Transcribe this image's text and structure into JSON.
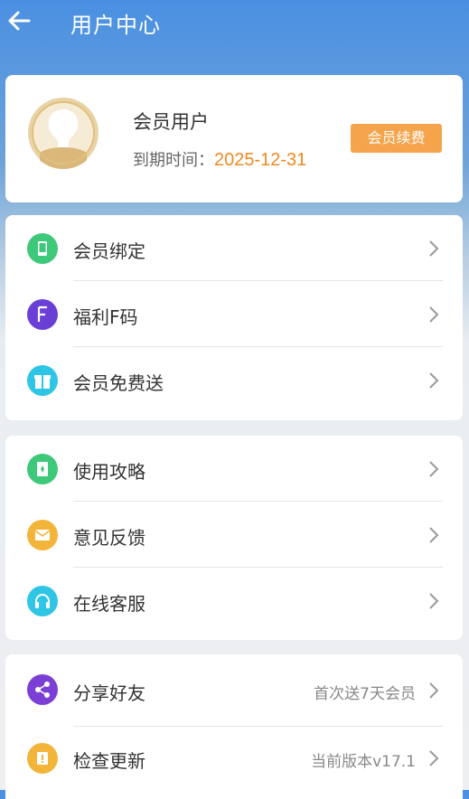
{
  "header": {
    "title": "用户中心"
  },
  "profile": {
    "name": "会员用户",
    "expire_label": "到期时间：",
    "expire_date": "2025-12-31",
    "renew_label": "会员续费"
  },
  "groups": [
    {
      "items": [
        {
          "label": "会员绑定",
          "icon": "phone-icon",
          "color": "#3ec87a"
        },
        {
          "label": "福利F码",
          "icon": "f-letter-icon",
          "color": "#6a3fd6"
        },
        {
          "label": "会员免费送",
          "icon": "gift-icon",
          "color": "#2fc5e5"
        }
      ]
    },
    {
      "items": [
        {
          "label": "使用攻略",
          "icon": "guide-icon",
          "color": "#3ec87a"
        },
        {
          "label": "意见反馈",
          "icon": "mail-icon",
          "color": "#f3b43a"
        },
        {
          "label": "在线客服",
          "icon": "headset-icon",
          "color": "#2fc5e5"
        }
      ]
    },
    {
      "items": [
        {
          "label": "分享好友",
          "icon": "share-icon",
          "color": "#7b3fd6",
          "extra": "首次送7天会员"
        },
        {
          "label": "检查更新",
          "icon": "update-icon",
          "color": "#f3b43a",
          "extra": "当前版本v17.1"
        }
      ]
    }
  ],
  "colors": {
    "accent": "#4a90e2",
    "orange": "#f5a44b",
    "date": "#ef8a23"
  }
}
